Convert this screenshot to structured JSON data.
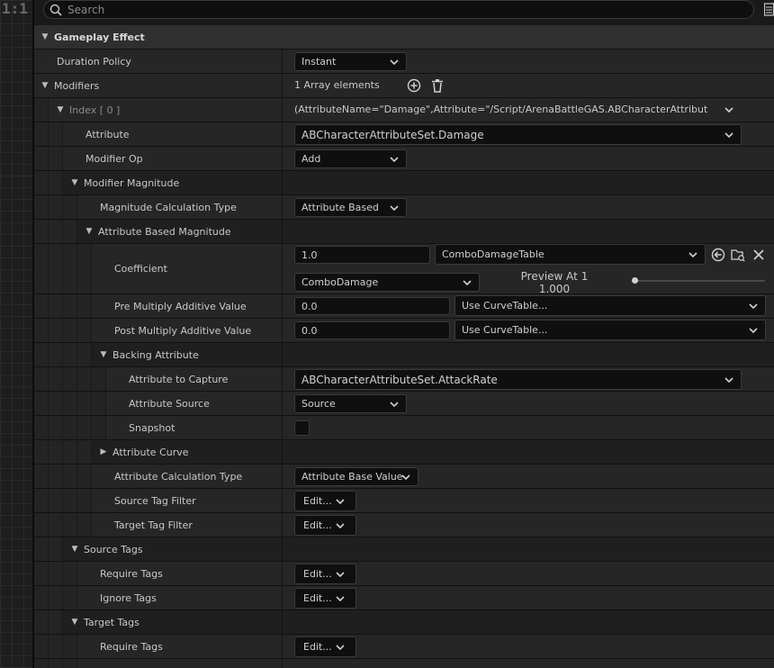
{
  "graph": {
    "label": "1:1"
  },
  "search": {
    "placeholder": "Search"
  },
  "rows": {
    "gameplay_effect": "Gameplay Effect",
    "duration_policy": {
      "label": "Duration Policy",
      "value": "Instant"
    },
    "modifiers": {
      "label": "Modifiers",
      "value": "1 Array elements"
    },
    "index": {
      "label": "Index [ 0 ]",
      "value": "(AttributeName=\"Damage\",Attribute=\"/Script/ArenaBattleGAS.ABCharacterAttributeSet:Dam"
    },
    "attribute": {
      "label": "Attribute",
      "value": "ABCharacterAttributeSet.Damage"
    },
    "modifier_op": {
      "label": "Modifier Op",
      "value": "Add"
    },
    "modifier_magnitude": {
      "label": "Modifier Magnitude"
    },
    "magnitude_calc_type": {
      "label": "Magnitude Calculation Type",
      "value": "Attribute Based"
    },
    "attribute_based_magnitude": {
      "label": "Attribute Based Magnitude"
    },
    "coefficient": {
      "label": "Coefficient",
      "value": "1.0",
      "curve_table": "ComboDamageTable",
      "row_name": "ComboDamage",
      "preview_label": "Preview At 1",
      "preview_value": "1.000",
      "preview_slider_level": 0
    },
    "pre_multiply": {
      "label": "Pre Multiply Additive Value",
      "value": "0.0",
      "curve": "Use CurveTable..."
    },
    "post_multiply": {
      "label": "Post Multiply Additive Value",
      "value": "0.0",
      "curve": "Use CurveTable..."
    },
    "backing_attribute": {
      "label": "Backing Attribute"
    },
    "attribute_to_capture": {
      "label": "Attribute to Capture",
      "value": "ABCharacterAttributeSet.AttackRate"
    },
    "attribute_source": {
      "label": "Attribute Source",
      "value": "Source"
    },
    "snapshot": {
      "label": "Snapshot",
      "checked": false
    },
    "attribute_curve": {
      "label": "Attribute Curve"
    },
    "attribute_calc_type": {
      "label": "Attribute Calculation Type",
      "value": "Attribute Base Value"
    },
    "source_tag_filter": {
      "label": "Source Tag Filter",
      "value": "Edit..."
    },
    "target_tag_filter": {
      "label": "Target Tag Filter",
      "value": "Edit..."
    },
    "source_tags": {
      "label": "Source Tags"
    },
    "source_require_tags": {
      "label": "Require Tags",
      "value": "Edit..."
    },
    "source_ignore_tags": {
      "label": "Ignore Tags",
      "value": "Edit..."
    },
    "target_tags": {
      "label": "Target Tags"
    },
    "target_require_tags": {
      "label": "Require Tags",
      "value": "Edit..."
    }
  },
  "colors": {
    "panel_bg": "#1a1a1a",
    "row_bg": "#262626",
    "category_bg": "#2f2f2f",
    "input_bg": "#0f0f0f",
    "text": "#c8c8c8"
  },
  "icons": [
    "search-icon",
    "view-options-icon",
    "chevron-down-icon",
    "add-element-icon",
    "delete-all-icon",
    "browse-arrow-icon",
    "browse-folder-icon",
    "close-icon",
    "expand-arrow-icon",
    "collapse-arrow-icon"
  ]
}
